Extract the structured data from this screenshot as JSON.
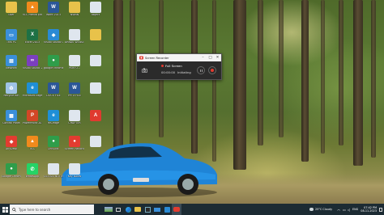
{
  "desktop_icons": [
    {
      "label": "user",
      "icon": "user-folder-icon",
      "color": "#e8c24a"
    },
    {
      "label": "VLC media player",
      "icon": "vlc-icon",
      "color": "#f08a1c"
    },
    {
      "label": "Word 2013",
      "icon": "word-icon",
      "color": "#2b5797"
    },
    {
      "label": "NWBN",
      "icon": "folder-icon",
      "color": "#e8c24a"
    },
    {
      "label": "object",
      "icon": "file-icon",
      "color": "#dfe6ee"
    },
    {
      "label": "This PC",
      "icon": "this-pc-icon",
      "color": "#3a8fd9"
    },
    {
      "label": "Excel 2013",
      "icon": "excel-icon",
      "color": "#1e7145"
    },
    {
      "label": "Visual Studio Code",
      "icon": "vscode-icon",
      "color": "#2a8ad4"
    },
    {
      "label": "ARNAV WEBSITE",
      "icon": "file-icon",
      "color": "#dfe6ee"
    },
    {
      "label": "",
      "icon": "folder-icon",
      "color": "#e8c24a"
    },
    {
      "label": "Network",
      "icon": "network-icon",
      "color": "#3a8fd9"
    },
    {
      "label": "Visual Studio 2022",
      "icon": "visual-studio-icon",
      "color": "#7b3fbf"
    },
    {
      "label": "google chrome",
      "icon": "chrome-icon",
      "color": "#2f9d4a"
    },
    {
      "label": "PERFO...",
      "icon": "file-icon",
      "color": "#dfe6ee"
    },
    {
      "label": "",
      "icon": "file-icon",
      "color": "#dfe6ee"
    },
    {
      "label": "Recycle Bin",
      "icon": "recycle-bin-icon",
      "color": "#9fc3e6"
    },
    {
      "label": "Microsoft Edge",
      "icon": "edge-icon",
      "color": "#1f8fd6"
    },
    {
      "label": "DOCX FILE",
      "icon": "docx-icon",
      "color": "#2b5797"
    },
    {
      "label": "PPTX FILE",
      "icon": "docx-icon",
      "color": "#2b5797"
    },
    {
      "label": "",
      "icon": "file-icon",
      "color": "#dfe6ee"
    },
    {
      "label": "Control Panel",
      "icon": "control-panel-icon",
      "color": "#3a8fd9"
    },
    {
      "label": "PowerPoint 2013",
      "icon": "powerpoint-icon",
      "color": "#d24726"
    },
    {
      "label": "ms-edge",
      "icon": "edge-icon",
      "color": "#1f8fd6"
    },
    {
      "label": "CHAPTER",
      "icon": "file-icon",
      "color": "#dfe6ee"
    },
    {
      "label": "",
      "icon": "pdf-icon",
      "color": "#e03a2f"
    },
    {
      "label": "AnyDesk",
      "icon": "anydesk-icon",
      "color": "#e23c30"
    },
    {
      "label": "VLC",
      "icon": "vlc-icon",
      "color": "#f08a1c"
    },
    {
      "label": "CHROME",
      "icon": "chrome-icon",
      "color": "#2f9d4a"
    },
    {
      "label": "Screen Recorder",
      "icon": "screen-recorder-icon",
      "color": "#e23c30"
    },
    {
      "label": "",
      "icon": "file-icon",
      "color": "#dfe6ee"
    },
    {
      "label": "Google Chrome",
      "icon": "chrome-icon",
      "color": "#2f9d4a"
    },
    {
      "label": "WhatsApp",
      "icon": "whatsapp-icon",
      "color": "#25d366"
    },
    {
      "label": "CS3303 NOTES",
      "icon": "file-icon",
      "color": "#dfe6ee"
    },
    {
      "label": "Key Notes",
      "icon": "file-icon",
      "color": "#dfe6ee"
    }
  ],
  "recorder": {
    "title": "Screen Recorder",
    "mode_label": "Full Screen",
    "timer": "00:00:00",
    "status": "Initiating"
  },
  "taskbar": {
    "search_placeholder": "Type here to search",
    "weather": "25°C  Cloudy",
    "language": "ENG",
    "time": "07:42 PM",
    "date": "08-11-2023"
  }
}
